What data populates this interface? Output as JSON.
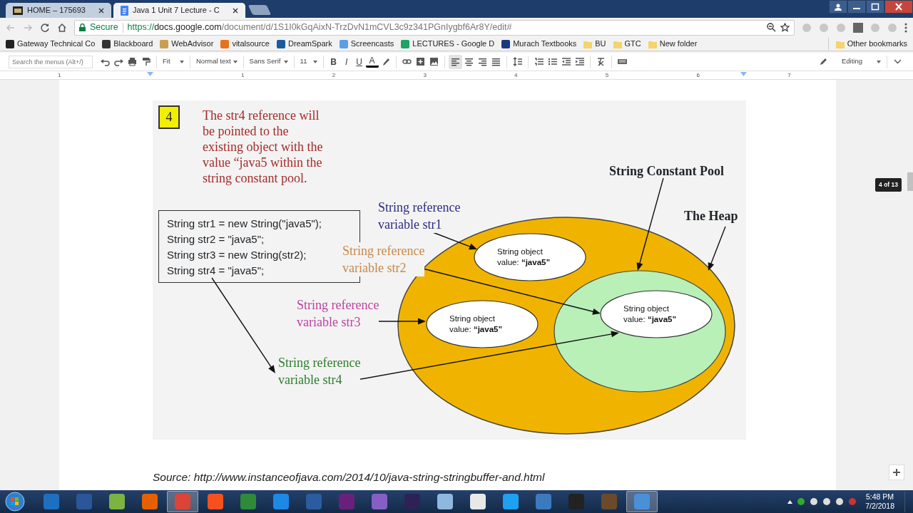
{
  "browser": {
    "tabs": [
      {
        "title": "HOME – 175693",
        "kind": "blackboard",
        "selected": false
      },
      {
        "title": "Java 1 Unit 7 Lecture - C",
        "kind": "docs",
        "selected": true
      }
    ],
    "security": "Secure",
    "url_scheme": "https://",
    "url_host": "docs.google.com",
    "url_path": "/document/d/1S1I0kGqAixN-TrzDvN1mCVL3c9z341PGnIygbf6Ar8Y/edit#"
  },
  "bookmarks": [
    {
      "label": "Gateway Technical Co",
      "kind": "site",
      "color": "#222222"
    },
    {
      "label": "Blackboard",
      "kind": "site",
      "color": "#333333"
    },
    {
      "label": "WebAdvisor",
      "kind": "site",
      "color": "#c8a050"
    },
    {
      "label": "vitalsource",
      "kind": "site",
      "color": "#e8711c"
    },
    {
      "label": "DreamSpark",
      "kind": "site",
      "color": "#1c5c9c"
    },
    {
      "label": "Screencasts",
      "kind": "site",
      "color": "#5aa0e0"
    },
    {
      "label": "LECTURES - Google D",
      "kind": "site",
      "color": "#1fa463"
    },
    {
      "label": "Murach Textbooks",
      "kind": "site",
      "color": "#1a3a80"
    },
    {
      "label": "BU",
      "kind": "folder"
    },
    {
      "label": "GTC",
      "kind": "folder"
    },
    {
      "label": "New folder",
      "kind": "folder"
    }
  ],
  "other_bookmarks": "Other bookmarks",
  "docs_toolbar": {
    "search_placeholder": "Search the menus (Alt+/)",
    "zoom": "Fit",
    "style": "Normal text",
    "font": "Sans Serif",
    "size": "11",
    "format_buttons": [
      "B",
      "I",
      "U",
      "A"
    ],
    "alignment": [
      {
        "kind": "left",
        "selected": true
      },
      {
        "kind": "center",
        "selected": false
      },
      {
        "kind": "right",
        "selected": false
      },
      {
        "kind": "justify",
        "selected": false
      }
    ],
    "mode": "Editing"
  },
  "ruler": [
    "1",
    "1",
    "2",
    "3",
    "4",
    "5",
    "6",
    "7"
  ],
  "document": {
    "diagram": {
      "step": "4",
      "note": [
        "The str4 reference will",
        "be pointed to the",
        "existing object with the",
        "value “java5 within the",
        "string constant pool."
      ],
      "code_lines": [
        "String str1 = new String(\"java5\");",
        "String str2 = \"java5\";",
        "String str3 = new String(str2);",
        "String str4 = \"java5\";"
      ],
      "pool_title": "String Constant Pool",
      "heap_title": "The Heap",
      "labels": [
        {
          "lines": [
            "String reference",
            "variable str1"
          ],
          "color": "#2b2b80"
        },
        {
          "lines": [
            "String reference",
            "variable str2"
          ],
          "color": "#c8884a"
        },
        {
          "lines": [
            "String reference",
            "variable str3"
          ],
          "color": "#c040a0"
        },
        {
          "lines": [
            "String reference",
            "variable str4"
          ],
          "color": "#2e7d2e"
        }
      ],
      "objects": [
        {
          "lines": [
            "String object",
            "value: **“java5”**"
          ]
        },
        {
          "lines": [
            "String object",
            "value: **“java5”**"
          ]
        },
        {
          "lines": [
            "String object",
            "value: **“java5”**"
          ]
        }
      ]
    },
    "caption": "Source: http://www.instanceofjava.com/2014/10/java-string-stringbuffer-and.html"
  },
  "page_indicator": "4 of 13",
  "taskbar": {
    "apps": [
      {
        "color": "#1f6fbf",
        "active": false
      },
      {
        "color": "#2b579a",
        "active": false
      },
      {
        "color": "#7cb342",
        "active": false
      },
      {
        "color": "#e66000",
        "active": false
      },
      {
        "color": "#db4437",
        "active": true
      },
      {
        "color": "#f4511e",
        "active": false
      },
      {
        "color": "#2e8b3a",
        "active": false
      },
      {
        "color": "#1e88e5",
        "active": false
      },
      {
        "color": "#2a5d9f",
        "active": false
      },
      {
        "color": "#68217a",
        "active": false
      },
      {
        "color": "#865fc5",
        "active": false
      },
      {
        "color": "#2c2255",
        "active": false
      },
      {
        "color": "#8fb8de",
        "active": false
      },
      {
        "color": "#e8e8e8",
        "active": false
      },
      {
        "color": "#1ea1f1",
        "active": false
      },
      {
        "color": "#3c7ac0",
        "active": false
      },
      {
        "color": "#222222",
        "active": false
      },
      {
        "color": "#6b4a2b",
        "active": false
      },
      {
        "color": "#4a90d9",
        "active": true
      }
    ],
    "time": "5:48 PM",
    "date": "7/2/2018"
  }
}
